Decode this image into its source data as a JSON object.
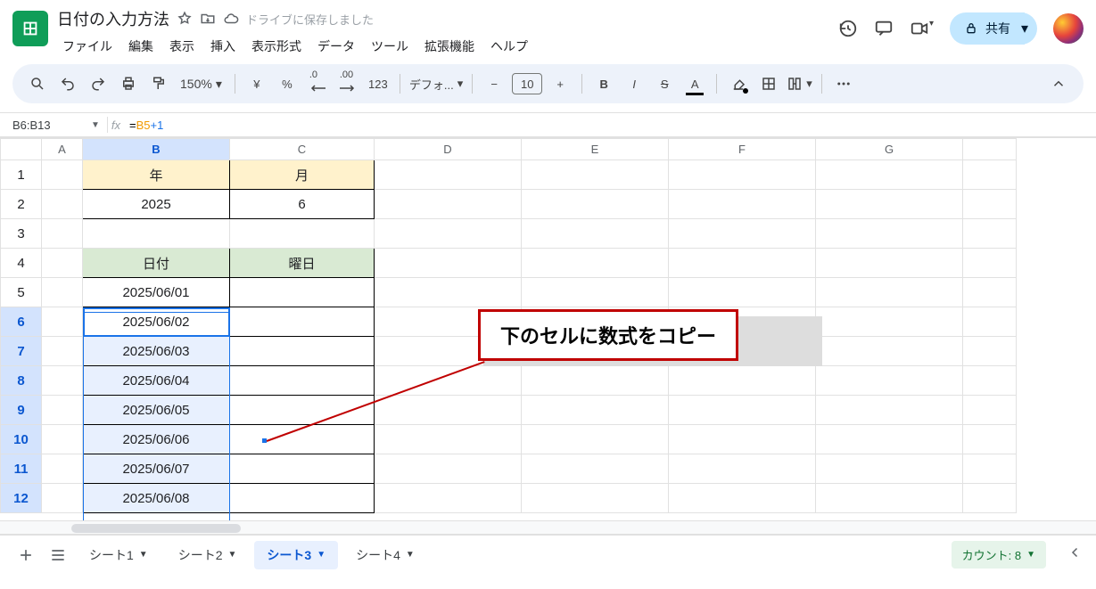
{
  "doc": {
    "title": "日付の入力方法",
    "saved_text": "ドライブに保存しました"
  },
  "menu": {
    "file": "ファイル",
    "edit": "編集",
    "view": "表示",
    "insert": "挿入",
    "format": "表示形式",
    "data": "データ",
    "tools": "ツール",
    "extensions": "拡張機能",
    "help": "ヘルプ"
  },
  "share": {
    "label": "共有"
  },
  "toolbar": {
    "zoom": "150%",
    "currency": "¥",
    "percent": "%",
    "dec_dec": ".0",
    "dec_inc": ".00",
    "num_fmt": "123",
    "font": "デフォ...",
    "font_size": "10"
  },
  "name_box": "B6:B13",
  "formula": {
    "ref": "B5",
    "op": "+1",
    "prefix": "="
  },
  "columns": [
    "A",
    "B",
    "C",
    "D",
    "E",
    "F",
    "G"
  ],
  "rows": {
    "r1": {
      "B": "年",
      "C": "月"
    },
    "r2": {
      "B": "2025",
      "C": "6"
    },
    "r4": {
      "B": "日付",
      "C": "曜日"
    },
    "r5": {
      "B": "2025/06/01"
    },
    "r6": {
      "B": "2025/06/02"
    },
    "r7": {
      "B": "2025/06/03"
    },
    "r8": {
      "B": "2025/06/04"
    },
    "r9": {
      "B": "2025/06/05"
    },
    "r10": {
      "B": "2025/06/06"
    },
    "r11": {
      "B": "2025/06/07"
    },
    "r12": {
      "B": "2025/06/08"
    }
  },
  "annotation": {
    "text": "下のセルに数式をコピー"
  },
  "tabs": {
    "sheet1": "シート1",
    "sheet2": "シート2",
    "sheet3": "シート3",
    "sheet4": "シート4"
  },
  "status": {
    "count_label": "カウント: 8"
  }
}
